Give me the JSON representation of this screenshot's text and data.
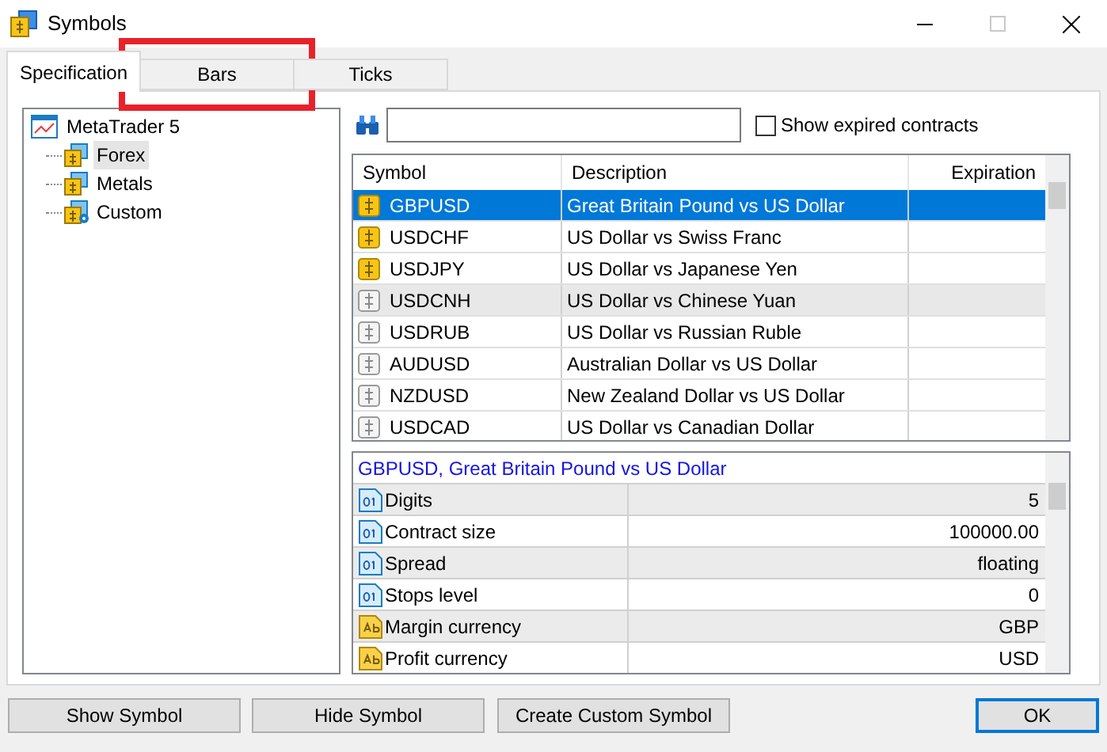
{
  "window": {
    "title": "Symbols"
  },
  "tabs": [
    {
      "label": "Specification",
      "selected": true,
      "highlighted": false
    },
    {
      "label": "Bars",
      "selected": false,
      "highlighted": true
    },
    {
      "label": "Ticks",
      "selected": false,
      "highlighted": false
    }
  ],
  "tree": {
    "label": "MetaTrader 5",
    "children": [
      {
        "label": "Forex",
        "kind": "currency",
        "selected": true
      },
      {
        "label": "Metals",
        "kind": "currency",
        "selected": false
      },
      {
        "label": "Custom",
        "kind": "custom",
        "selected": false
      }
    ]
  },
  "show_expired": {
    "label": "Show expired contracts",
    "checked": false
  },
  "symbols": {
    "columns": [
      "Symbol",
      "Description",
      "Expiration"
    ],
    "rows": [
      {
        "symbol": "GBPUSD",
        "description": "Great Britain Pound vs US Dollar",
        "active": true,
        "selected": true,
        "hovered": false
      },
      {
        "symbol": "USDCHF",
        "description": "US Dollar vs Swiss Franc",
        "active": true,
        "selected": false,
        "hovered": false
      },
      {
        "symbol": "USDJPY",
        "description": "US Dollar vs Japanese Yen",
        "active": true,
        "selected": false,
        "hovered": false
      },
      {
        "symbol": "USDCNH",
        "description": "US Dollar vs Chinese Yuan",
        "active": false,
        "selected": false,
        "hovered": true
      },
      {
        "symbol": "USDRUB",
        "description": "US Dollar vs Russian Ruble",
        "active": false,
        "selected": false,
        "hovered": false
      },
      {
        "symbol": "AUDUSD",
        "description": "Australian Dollar vs US Dollar",
        "active": false,
        "selected": false,
        "hovered": false
      },
      {
        "symbol": "NZDUSD",
        "description": "New Zealand Dollar vs US Dollar",
        "active": false,
        "selected": false,
        "hovered": false
      },
      {
        "symbol": "USDCAD",
        "description": "US Dollar vs Canadian Dollar",
        "active": false,
        "selected": false,
        "hovered": false
      }
    ]
  },
  "properties": {
    "title": "GBPUSD, Great Britain Pound vs US Dollar",
    "rows": [
      {
        "name": "Digits",
        "value": "5",
        "kind": "number"
      },
      {
        "name": "Contract size",
        "value": "100000.00",
        "kind": "number"
      },
      {
        "name": "Spread",
        "value": "floating",
        "kind": "number"
      },
      {
        "name": "Stops level",
        "value": "0",
        "kind": "number"
      },
      {
        "name": "Margin currency",
        "value": "GBP",
        "kind": "text"
      },
      {
        "name": "Profit currency",
        "value": "USD",
        "kind": "text"
      }
    ]
  },
  "buttons": [
    {
      "label": "Show Symbol",
      "default": false
    },
    {
      "label": "Hide Symbol",
      "default": false
    },
    {
      "label": "Create Custom Symbol",
      "default": false
    },
    {
      "label": "OK",
      "default": true
    }
  ]
}
